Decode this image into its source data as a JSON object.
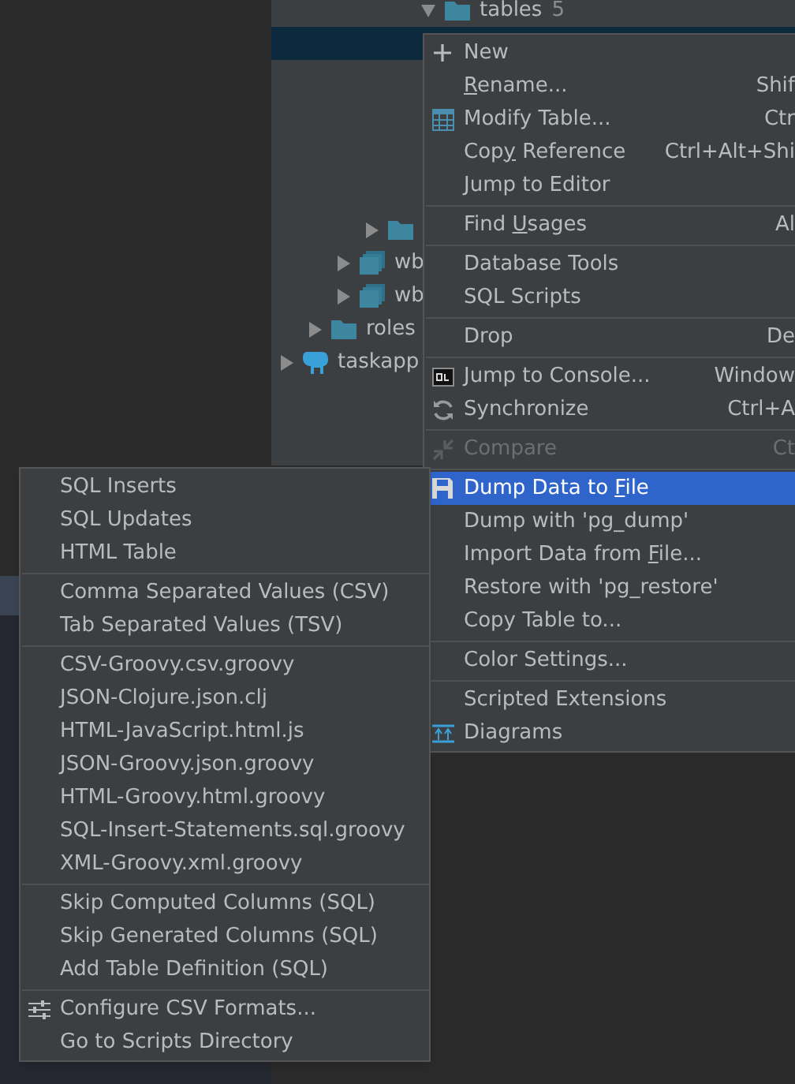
{
  "tree": [
    {
      "children": [
        {
          "children": [
            {
              "children": [
                {
                  "children": [
                    {
                      "children": [
                        {
                          "label": "tables",
                          "count": "5",
                          "kind": "folder",
                          "expanded": true,
                          "children": [
                            {
                              "selected": true
                            }
                          ]
                        }
                      ]
                    }
                  ]
                },
                {
                  "kind": "folder",
                  "expanded": false
                }
              ]
            },
            {
              "label": "wb",
              "kind": "schema",
              "expanded": false
            },
            {
              "label": "wb",
              "kind": "schema",
              "expanded": false
            }
          ]
        },
        {
          "label": "roles",
          "kind": "folder",
          "expanded": false
        }
      ]
    },
    {
      "label": "taskapp",
      "kind": "database",
      "expanded": false
    }
  ],
  "context_menu": [
    {
      "kind": "item",
      "label": "New",
      "selected": false,
      "disabled": false
    },
    {
      "kind": "item",
      "label_parts": [
        {
          "text": "R",
          "underlined": true
        },
        {
          "text": "ename...",
          "underlined": false
        }
      ],
      "shortcut": "Shif",
      "selected": false,
      "disabled": false
    },
    {
      "kind": "item",
      "label": "Modify Table...",
      "shortcut": "Ctr",
      "selected": false,
      "disabled": false
    },
    {
      "kind": "item",
      "label_parts": [
        {
          "text": "Cop",
          "underlined": false
        },
        {
          "text": "y",
          "underlined": true
        },
        {
          "text": " Reference",
          "underlined": false
        }
      ],
      "shortcut": "Ctrl+Alt+Shi",
      "selected": false,
      "disabled": false
    },
    {
      "kind": "item",
      "label": "Jump to Editor",
      "selected": false,
      "disabled": false
    },
    {
      "kind": "separator"
    },
    {
      "kind": "item",
      "label_parts": [
        {
          "text": "Find ",
          "underlined": false
        },
        {
          "text": "U",
          "underlined": true
        },
        {
          "text": "sages",
          "underlined": false
        }
      ],
      "shortcut": "Al",
      "selected": false,
      "disabled": false
    },
    {
      "kind": "separator"
    },
    {
      "kind": "item",
      "label": "Database Tools",
      "selected": false,
      "disabled": false
    },
    {
      "kind": "item",
      "label": "SQL Scripts",
      "selected": false,
      "disabled": false
    },
    {
      "kind": "separator"
    },
    {
      "kind": "item",
      "label": "Drop",
      "shortcut": "De",
      "selected": false,
      "disabled": false
    },
    {
      "kind": "separator"
    },
    {
      "kind": "item",
      "label": "Jump to Console...",
      "shortcut": "Window",
      "selected": false,
      "disabled": false
    },
    {
      "kind": "item",
      "label": "Synchronize",
      "shortcut": "Ctrl+A",
      "selected": false,
      "disabled": false
    },
    {
      "kind": "separator"
    },
    {
      "kind": "item",
      "label": "Compare",
      "shortcut": "Ct",
      "selected": false,
      "disabled": true
    },
    {
      "kind": "separator"
    },
    {
      "kind": "item",
      "label_parts": [
        {
          "text": "Dump Data to ",
          "underlined": false
        },
        {
          "text": "F",
          "underlined": true
        },
        {
          "text": "ile",
          "underlined": false
        }
      ],
      "selected": true,
      "disabled": false
    },
    {
      "kind": "item",
      "label": "Dump with 'pg_dump'",
      "selected": false,
      "disabled": false
    },
    {
      "kind": "item",
      "label_parts": [
        {
          "text": "Import Data from ",
          "underlined": false
        },
        {
          "text": "F",
          "underlined": true
        },
        {
          "text": "ile...",
          "underlined": false
        }
      ],
      "selected": false,
      "disabled": false
    },
    {
      "kind": "item",
      "label": "Restore with 'pg_restore'",
      "selected": false,
      "disabled": false
    },
    {
      "kind": "item",
      "label": "Copy Table to...",
      "selected": false,
      "disabled": false
    },
    {
      "kind": "separator"
    },
    {
      "kind": "item",
      "label": "Color Settings...",
      "selected": false,
      "disabled": false
    },
    {
      "kind": "separator"
    },
    {
      "kind": "item",
      "label": "Scripted Extensions",
      "selected": false,
      "disabled": false
    },
    {
      "kind": "item",
      "label": "Diagrams",
      "selected": false,
      "disabled": false
    }
  ],
  "submenu": [
    {
      "kind": "item",
      "label": "SQL Inserts",
      "selected": false
    },
    {
      "kind": "item",
      "label": "SQL Updates",
      "selected": false
    },
    {
      "kind": "item",
      "label": "HTML Table",
      "selected": false
    },
    {
      "kind": "separator"
    },
    {
      "kind": "item",
      "label": "Comma Separated Values (CSV)",
      "selected": false
    },
    {
      "kind": "item",
      "label": "Tab Separated Values (TSV)",
      "selected": false
    },
    {
      "kind": "separator"
    },
    {
      "kind": "item",
      "label": "CSV-Groovy.csv.groovy",
      "selected": false
    },
    {
      "kind": "item",
      "label": "JSON-Clojure.json.clj",
      "selected": false
    },
    {
      "kind": "item",
      "label": "HTML-JavaScript.html.js",
      "selected": false
    },
    {
      "kind": "item",
      "label": "JSON-Groovy.json.groovy",
      "selected": false
    },
    {
      "kind": "item",
      "label": "HTML-Groovy.html.groovy",
      "selected": false
    },
    {
      "kind": "item",
      "label": "SQL-Insert-Statements.sql.groovy",
      "selected": false
    },
    {
      "kind": "item",
      "label": "XML-Groovy.xml.groovy",
      "selected": false
    },
    {
      "kind": "separator"
    },
    {
      "kind": "item",
      "label": "Skip Computed Columns (SQL)",
      "selected": false
    },
    {
      "kind": "item",
      "label": "Skip Generated Columns (SQL)",
      "selected": false
    },
    {
      "kind": "item",
      "label": "Add Table Definition (SQL)",
      "selected": false
    },
    {
      "kind": "separator"
    },
    {
      "kind": "item",
      "label": "Configure CSV Formats...",
      "selected": false
    },
    {
      "kind": "item",
      "label": "Go to Scripts Directory",
      "selected": false
    }
  ]
}
